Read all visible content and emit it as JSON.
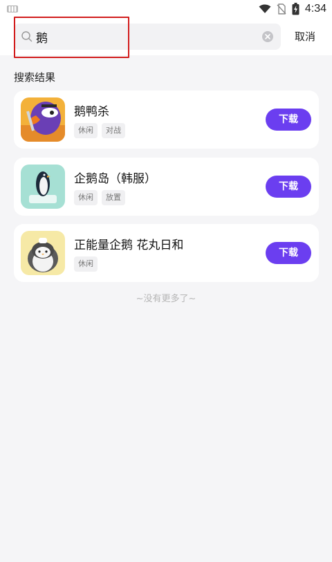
{
  "status_bar": {
    "time": "4:34"
  },
  "search": {
    "query": "鹅",
    "cancel_label": "取消"
  },
  "results": {
    "section_title": "搜索结果",
    "items": [
      {
        "name": "鹅鸭杀",
        "tags": [
          "休闲",
          "对战"
        ],
        "download_label": "下载"
      },
      {
        "name": "企鹅岛（韩服）",
        "tags": [
          "休闲",
          "放置"
        ],
        "download_label": "下载"
      },
      {
        "name": "正能量企鹅 花丸日和",
        "tags": [
          "休闲"
        ],
        "download_label": "下载"
      }
    ],
    "end_text": "~没有更多了~"
  },
  "colors": {
    "accent": "#6b3ef0",
    "highlight": "#d21b1b"
  }
}
